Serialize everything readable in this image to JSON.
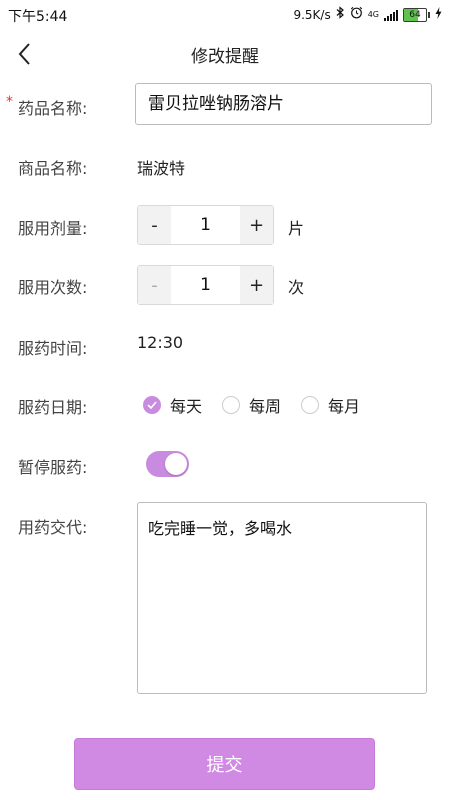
{
  "status_bar": {
    "time": "下午5:44",
    "net_speed": "9.5K/s",
    "bluetooth_icon": "bluetooth-icon",
    "alarm_icon": "alarm-icon",
    "network_type": "4G",
    "battery_level": "64",
    "charging_icon": "charging-icon"
  },
  "header": {
    "back_icon": "back-arrow-icon",
    "title": "修改提醒"
  },
  "form": {
    "required_mark": "*",
    "drug_name": {
      "label": "药品名称:",
      "value": "雷贝拉唑钠肠溶片"
    },
    "brand_name": {
      "label": "商品名称:",
      "value": "瑞波特"
    },
    "dosage": {
      "label": "服用剂量:",
      "minus": "-",
      "value": "1",
      "plus": "+",
      "unit": "片"
    },
    "times": {
      "label": "服用次数:",
      "minus": "-",
      "value": "1",
      "plus": "+",
      "unit": "次"
    },
    "time": {
      "label": "服药时间:",
      "value": "12:30"
    },
    "date": {
      "label": "服药日期:",
      "options": [
        {
          "label": "每天",
          "checked": true
        },
        {
          "label": "每周",
          "checked": false
        },
        {
          "label": "每月",
          "checked": false
        }
      ]
    },
    "pause": {
      "label": "暂停服药:",
      "on": true
    },
    "instructions": {
      "label": "用药交代:",
      "value": "吃完睡一觉，多喝水"
    }
  },
  "submit_label": "提交",
  "colors": {
    "accent": "#c98be0",
    "submit_bg": "#d18ae4",
    "required": "#dd3333"
  }
}
